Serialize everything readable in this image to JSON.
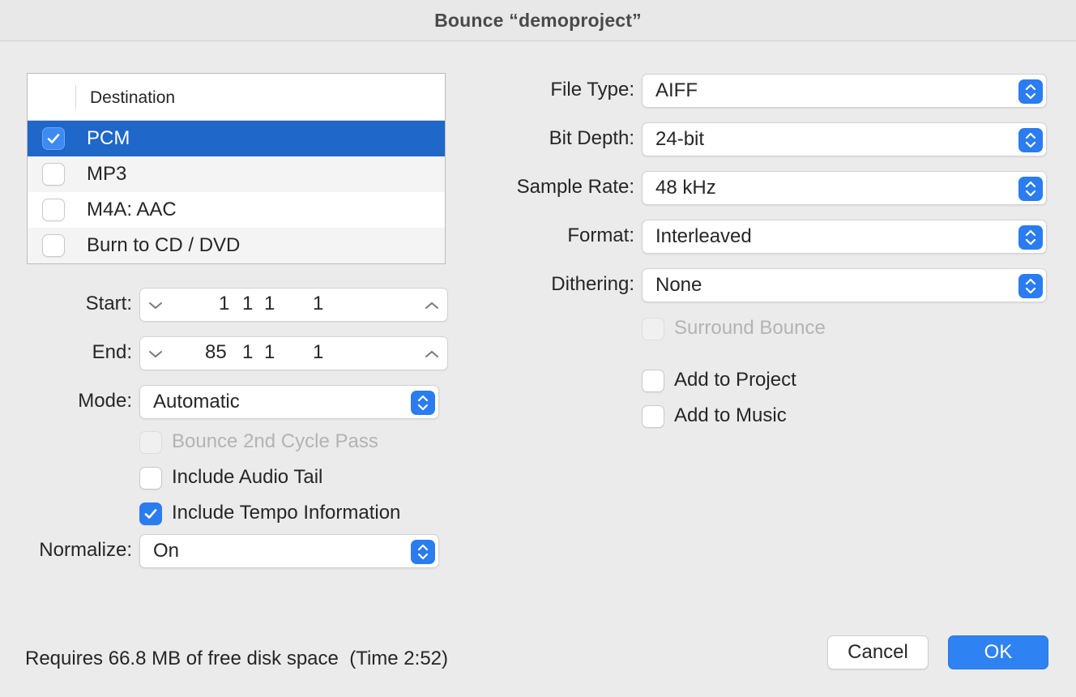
{
  "window": {
    "title": "Bounce “demoproject”"
  },
  "destination": {
    "header": "Destination",
    "rows": [
      {
        "label": "PCM",
        "checked": true,
        "selected": true
      },
      {
        "label": "MP3",
        "checked": false
      },
      {
        "label": "M4A: AAC",
        "checked": false
      },
      {
        "label": "Burn to CD / DVD",
        "checked": false
      }
    ]
  },
  "left": {
    "start": {
      "label": "Start:",
      "values": [
        "1",
        "1",
        "1",
        "1"
      ]
    },
    "end": {
      "label": "End:",
      "values": [
        "85",
        "1",
        "1",
        "1"
      ]
    },
    "mode": {
      "label": "Mode:",
      "value": "Automatic"
    },
    "bounce_2nd_cycle": {
      "label": "Bounce 2nd Cycle Pass",
      "checked": false,
      "enabled": false
    },
    "include_audio_tail": {
      "label": "Include Audio Tail",
      "checked": false
    },
    "include_tempo": {
      "label": "Include Tempo Information",
      "checked": true
    },
    "normalize": {
      "label": "Normalize:",
      "value": "On"
    }
  },
  "right": {
    "file_type": {
      "label": "File Type:",
      "value": "AIFF"
    },
    "bit_depth": {
      "label": "Bit Depth:",
      "value": "24-bit"
    },
    "sample_rate": {
      "label": "Sample Rate:",
      "value": "48 kHz"
    },
    "format": {
      "label": "Format:",
      "value": "Interleaved"
    },
    "dithering": {
      "label": "Dithering:",
      "value": "None"
    },
    "surround_bounce": {
      "label": "Surround Bounce",
      "checked": false,
      "enabled": false
    },
    "add_to_project": {
      "label": "Add to Project",
      "checked": false
    },
    "add_to_music": {
      "label": "Add to Music",
      "checked": false
    }
  },
  "footer": {
    "status": "Requires 66.8 MB of free disk space  (Time 2:52)",
    "cancel_label": "Cancel",
    "ok_label": "OK"
  },
  "colors": {
    "accent": "#2a7cf0",
    "selection": "#1f67c9",
    "background": "#ecebeb"
  }
}
